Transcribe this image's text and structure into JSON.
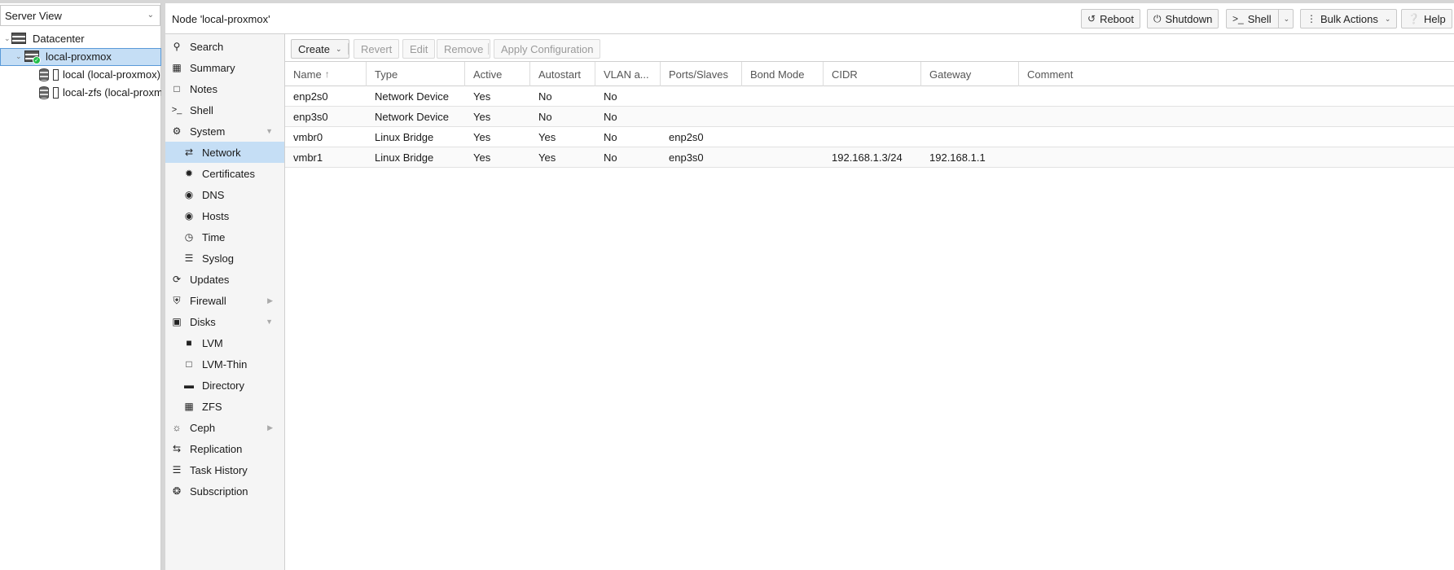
{
  "tree": {
    "view_label": "Server View",
    "datacenter_label": "Datacenter",
    "node_label": "local-proxmox",
    "storages": [
      {
        "label": "local (local-proxmox)"
      },
      {
        "label": "local-zfs (local-proxmox)"
      }
    ]
  },
  "header": {
    "title": "Node 'local-proxmox'",
    "reboot_label": "Reboot",
    "shutdown_label": "Shutdown",
    "shell_label": "Shell",
    "bulk_actions_label": "Bulk Actions",
    "help_label": "Help"
  },
  "menu": {
    "search": "Search",
    "summary": "Summary",
    "notes": "Notes",
    "shell": "Shell",
    "system": "System",
    "network": "Network",
    "certificates": "Certificates",
    "dns": "DNS",
    "hosts": "Hosts",
    "time": "Time",
    "syslog": "Syslog",
    "updates": "Updates",
    "firewall": "Firewall",
    "disks": "Disks",
    "lvm": "LVM",
    "lvm_thin": "LVM-Thin",
    "directory": "Directory",
    "zfs": "ZFS",
    "ceph": "Ceph",
    "replication": "Replication",
    "task_history": "Task History",
    "subscription": "Subscription"
  },
  "toolbar": {
    "create_label": "Create",
    "revert_label": "Revert",
    "edit_label": "Edit",
    "remove_label": "Remove",
    "apply_label": "Apply Configuration"
  },
  "grid": {
    "columns": [
      "Name",
      "Type",
      "Active",
      "Autostart",
      "VLAN a...",
      "Ports/Slaves",
      "Bond Mode",
      "CIDR",
      "Gateway",
      "Comment"
    ],
    "rows": [
      [
        "enp2s0",
        "Network Device",
        "Yes",
        "No",
        "No",
        "",
        "",
        "",
        "",
        ""
      ],
      [
        "enp3s0",
        "Network Device",
        "Yes",
        "No",
        "No",
        "",
        "",
        "",
        "",
        ""
      ],
      [
        "vmbr0",
        "Linux Bridge",
        "Yes",
        "Yes",
        "No",
        "enp2s0",
        "",
        "",
        "",
        ""
      ],
      [
        "vmbr1",
        "Linux Bridge",
        "Yes",
        "Yes",
        "No",
        "enp3s0",
        "",
        "192.168.1.3/24",
        "192.168.1.1",
        ""
      ]
    ]
  },
  "colors": {
    "selection": "#c5def5",
    "node_status_ok": "#21bf4b"
  }
}
